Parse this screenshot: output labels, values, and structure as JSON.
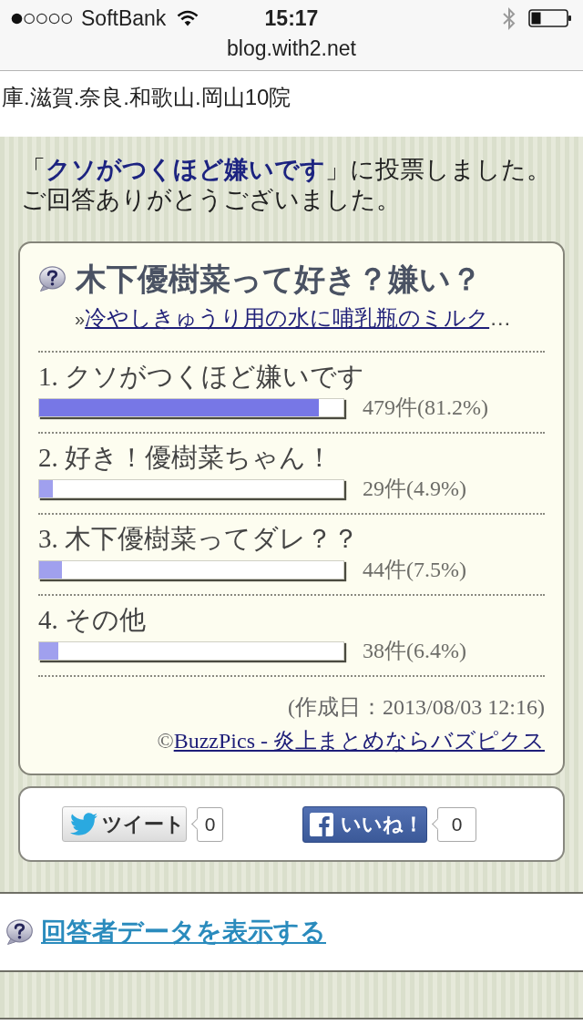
{
  "status_bar": {
    "carrier": "SoftBank",
    "time": "15:17"
  },
  "address_bar": {
    "url": "blog.with2.net"
  },
  "article_tail": {
    "text": "庫.滋賀.奈良.和歌山.岡山10院"
  },
  "vote_message": {
    "lines": [
      "「**クソがつくほど嫌いです**」に投票しました。",
      "ご回答ありがとうございました。"
    ]
  },
  "poll": {
    "title": "木下優樹菜って好き？嫌い？",
    "related_link": {
      "marker": "»",
      "label": "冷やしきゅうり用の水に哺乳瓶のミルク",
      "ellipsis": "…"
    },
    "options": [
      {
        "label": "1. クソがつくほど嫌いです",
        "selected": true,
        "level": 0.92,
        "result": "479件(81.2%)"
      },
      {
        "label": "2. 好き！優樹菜ちゃん！",
        "selected": false,
        "level": 0.045,
        "result": "29件(4.9%)"
      },
      {
        "label": "3. 木下優樹菜ってダレ？？",
        "selected": false,
        "level": 0.074,
        "result": "44件(7.5%)"
      },
      {
        "label": "4. その他",
        "selected": false,
        "level": 0.062,
        "result": "38件(6.4%)"
      }
    ],
    "created": "(作成日：2013/08/03 12:16)",
    "credit": {
      "mark": "©",
      "link": "BuzzPics - 炎上まとめならバズピクス"
    }
  },
  "share": {
    "buttons": [
      {
        "kind": "tweet",
        "label": "ツイート",
        "count": "0"
      },
      {
        "kind": "like",
        "label": "いいね！",
        "count": "0"
      }
    ]
  },
  "respondent_link": {
    "label": "回答者データを表示する"
  }
}
